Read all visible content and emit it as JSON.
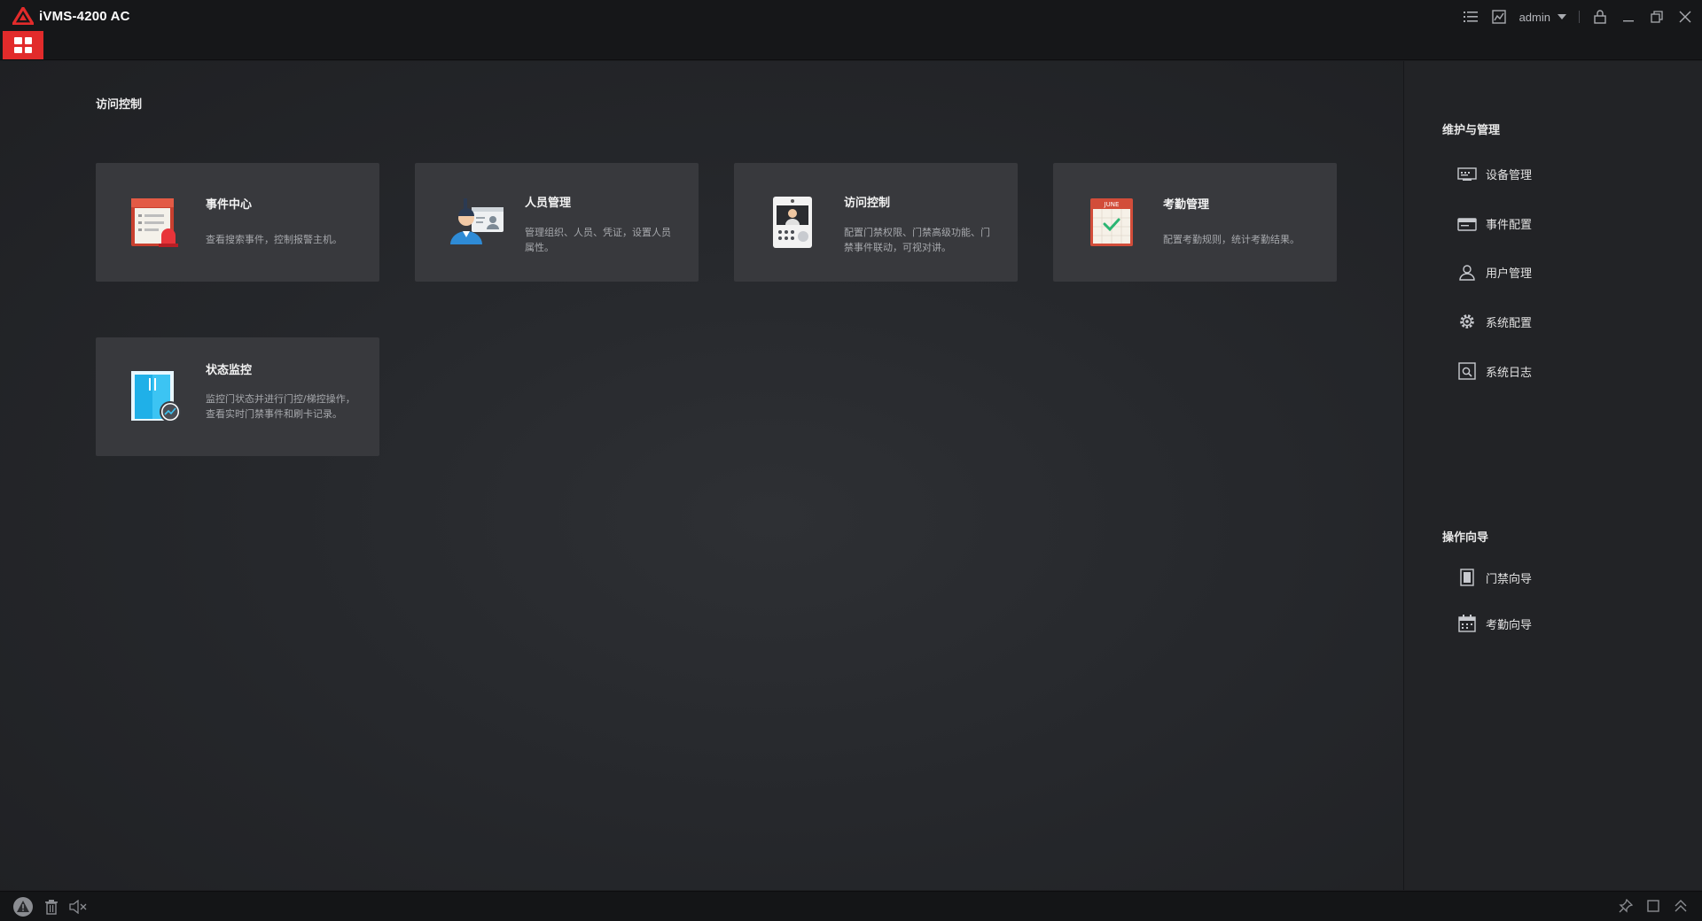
{
  "app": {
    "title": "iVMS-4200 AC",
    "user": "admin"
  },
  "main": {
    "section_title": "访问控制",
    "cards": [
      {
        "title": "事件中心",
        "desc": "查看搜索事件，控制报警主机。",
        "icon": "event-center-icon"
      },
      {
        "title": "人员管理",
        "desc": "管理组织、人员、凭证，设置人员属性。",
        "icon": "person-management-icon"
      },
      {
        "title": "访问控制",
        "desc": "配置门禁权限、门禁高级功能、门禁事件联动，可视对讲。",
        "icon": "access-control-icon"
      },
      {
        "title": "考勤管理",
        "desc": "配置考勤规则，统计考勤结果。",
        "icon": "attendance-icon"
      },
      {
        "title": "状态监控",
        "desc": "监控门状态并进行门控/梯控操作，查看实时门禁事件和刷卡记录。",
        "icon": "status-monitor-icon"
      }
    ]
  },
  "right_panel": {
    "maintenance": {
      "title": "维护与管理",
      "items": [
        {
          "label": "设备管理",
          "icon": "device-icon"
        },
        {
          "label": "事件配置",
          "icon": "event-config-icon"
        },
        {
          "label": "用户管理",
          "icon": "user-icon"
        },
        {
          "label": "系统配置",
          "icon": "gear-icon"
        },
        {
          "label": "系统日志",
          "icon": "log-icon"
        }
      ]
    },
    "wizard": {
      "title": "操作向导",
      "items": [
        {
          "label": "门禁向导",
          "icon": "door-wizard-icon"
        },
        {
          "label": "考勤向导",
          "icon": "calendar-wizard-icon"
        }
      ]
    }
  },
  "calendar_month": "JUNE",
  "colors": {
    "accent": "#e22b2b",
    "card_bg": "#38393d",
    "titlebar_bg": "#161719"
  }
}
